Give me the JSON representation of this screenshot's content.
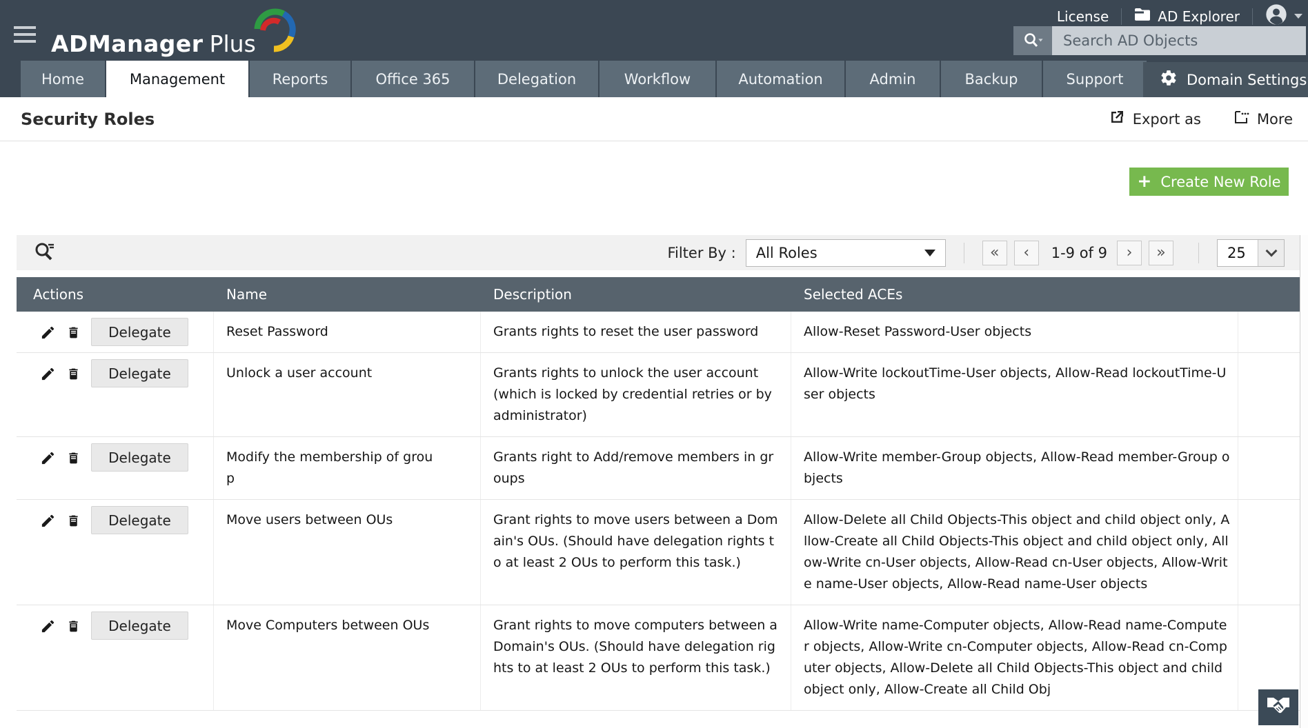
{
  "header": {
    "logo_text_bold": "ADManager",
    "logo_text_regular": "Plus",
    "license_label": "License",
    "ad_explorer_label": "AD Explorer",
    "search_placeholder": "Search AD Objects"
  },
  "nav": {
    "tabs": [
      {
        "label": "Home"
      },
      {
        "label": "Management"
      },
      {
        "label": "Reports"
      },
      {
        "label": "Office 365"
      },
      {
        "label": "Delegation"
      },
      {
        "label": "Workflow"
      },
      {
        "label": "Automation"
      },
      {
        "label": "Admin"
      },
      {
        "label": "Backup"
      },
      {
        "label": "Support"
      }
    ],
    "active_tab": "Management",
    "domain_settings_label": "Domain Settings"
  },
  "page": {
    "title": "Security Roles",
    "export_as_label": "Export as",
    "more_label": "More",
    "create_button_label": "Create New Role",
    "create_button_plus": "+"
  },
  "filter": {
    "filter_by_label": "Filter By :",
    "selected_value": "All Roles",
    "range_text": "1-9 of 9",
    "page_size": "25",
    "pager_first": "«",
    "pager_prev": "‹",
    "pager_next": "›",
    "pager_last": "»"
  },
  "table": {
    "columns": [
      "Actions",
      "Name",
      "Description",
      "Selected ACEs"
    ],
    "delegate_label": "Delegate",
    "rows": [
      {
        "name": "Reset Password",
        "description": "Grants rights to reset the user password",
        "aces": "Allow-Reset Password-User objects"
      },
      {
        "name": "Unlock a user account",
        "description": "Grants rights to unlock the user account (which is locked by credential retries or by administrator)",
        "aces": "Allow-Write lockoutTime-User objects, Allow-Read lockoutTime-User objects"
      },
      {
        "name": "Modify the membership of group",
        "description": "Grants right to Add/remove members in groups",
        "aces": "Allow-Write member-Group objects, Allow-Read member-Group objects"
      },
      {
        "name": "Move users between OUs",
        "description": "Grant rights to move users between a Domain's OUs. (Should have delegation rights to at least 2 OUs to perform this task.)",
        "aces": "Allow-Delete all Child Objects-This object and child object only, Allow-Create all Child Objects-This object and child object only, Allow-Write cn-User objects, Allow-Read cn-User objects, Allow-Write name-User objects, Allow-Read name-User objects"
      },
      {
        "name": "Move Computers between OUs",
        "description": "Grant rights to move computers between a Domain's OUs. (Should have delegation rights to at least 2 OUs to perform this task.)",
        "aces": "Allow-Write name-Computer objects, Allow-Read name-Computer objects, Allow-Write cn-Computer objects, Allow-Read cn-Computer objects, Allow-Delete all Child Objects-This object and child object only, Allow-Create all Child Obj"
      }
    ]
  },
  "colors": {
    "header_bg": "#3b4753",
    "tab_bg": "#5d6c78",
    "accent_green": "#77b94e",
    "table_header_bg": "#57636d",
    "filter_bar_bg": "#f1f1f1"
  }
}
